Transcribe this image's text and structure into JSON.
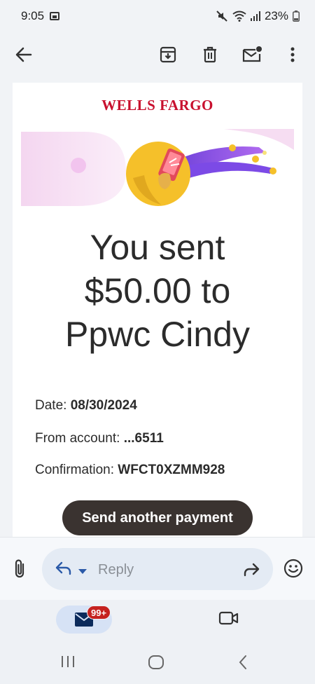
{
  "status_bar": {
    "time": "9:05",
    "battery": "23%"
  },
  "toolbar": {
    "icons": [
      "back-arrow-icon",
      "archive-icon",
      "delete-icon",
      "mark-unread-icon",
      "more-vert-icon"
    ]
  },
  "email": {
    "brand": "WELLS FARGO",
    "headline_lines": [
      "You sent",
      "$50.00 to",
      "Ppwc Cindy"
    ],
    "details": [
      {
        "label": "Date:",
        "value": "08/30/2024"
      },
      {
        "label": "From account:",
        "value": "...6511"
      },
      {
        "label": "Confirmation:",
        "value": "WFCT0XZMM928"
      }
    ],
    "cta_label": "Send another payment"
  },
  "reply_bar": {
    "placeholder": "Reply"
  },
  "bottom_nav": {
    "mail_badge": "99+"
  },
  "colors": {
    "brand_red": "#c8102e",
    "cta_bg": "#3a3330",
    "badge_red": "#c5221f",
    "accent_purple": "#8a4fe0",
    "accent_yellow": "#f5c02a"
  }
}
